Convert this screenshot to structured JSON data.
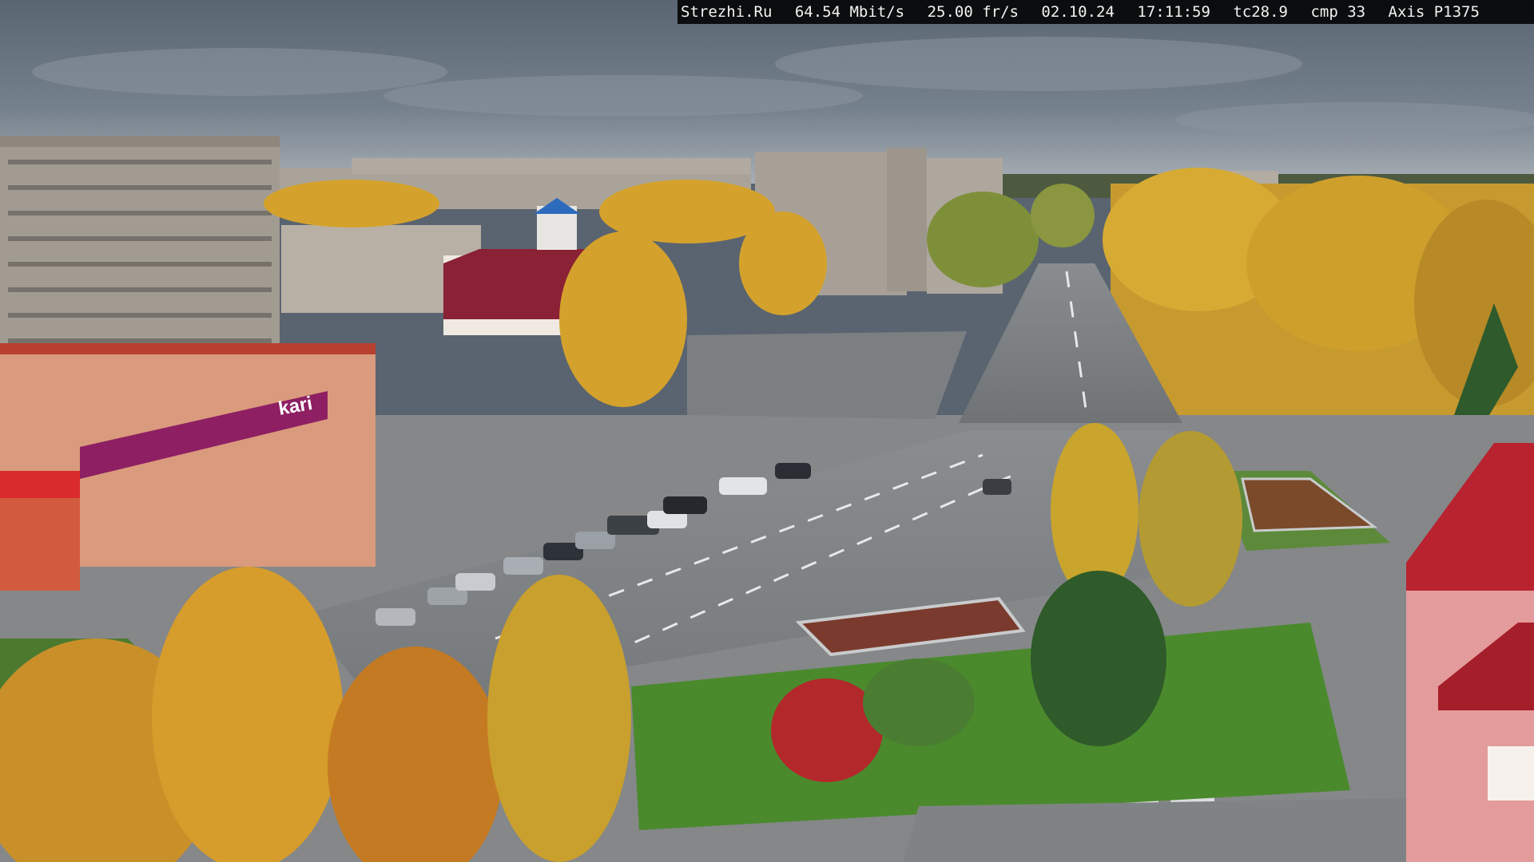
{
  "overlay": {
    "site": "Strezhi.Ru",
    "bitrate": "64.54 Mbit/s",
    "framerate": "25.00 fr/s",
    "date": "02.10.24",
    "time": "17:11:59",
    "temperature": "tc28.9",
    "compression": "cmp 33",
    "camera_model": "Axis P1375"
  },
  "scene": {
    "storefront_sign": "kari",
    "sky_color": "#6f7a87",
    "foliage_color": "#d9a62b",
    "asphalt_color": "#7b7f82",
    "grass_color": "#4f8a2e",
    "accent_red": "#b8232f"
  }
}
